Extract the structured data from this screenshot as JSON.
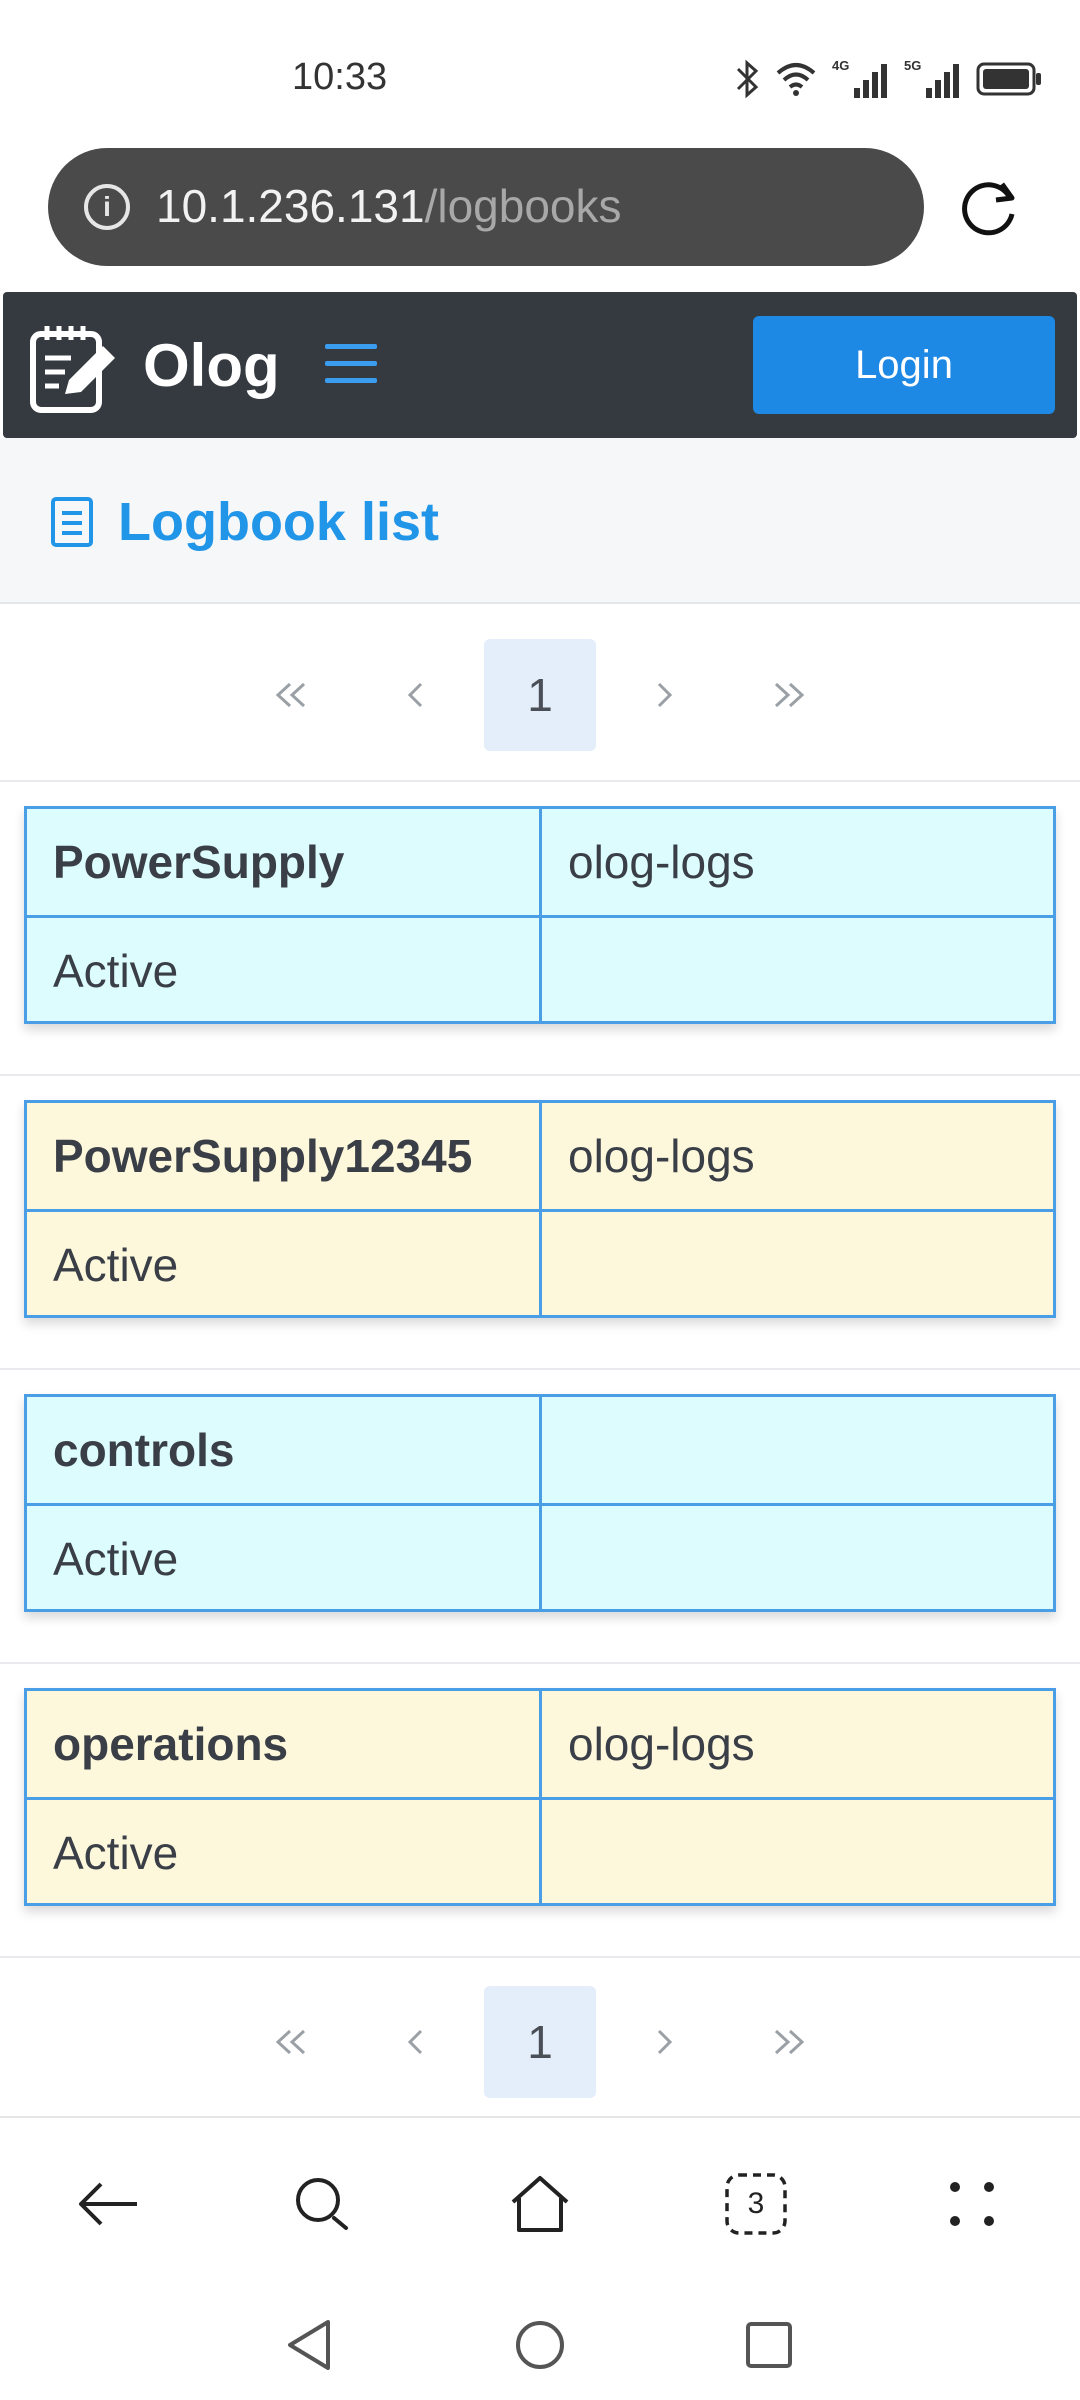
{
  "status_bar": {
    "time": "10:33",
    "icons": [
      "bluetooth-icon",
      "wifi-icon",
      "signal-4g-icon",
      "signal-5g-icon",
      "battery-icon"
    ],
    "network_4g": "4G",
    "network_5g": "5G"
  },
  "browser": {
    "url_host": "10.1.236.131",
    "url_path": "/logbooks",
    "info_glyph": "i",
    "tabs_count": "3"
  },
  "navbar": {
    "brand": "Olog",
    "login_label": "Login",
    "brand_color": "#343a40",
    "accent": "#1e88e5"
  },
  "header": {
    "title": "Logbook list",
    "title_color": "#2196e8"
  },
  "pagination": {
    "current_page": "1"
  },
  "logbooks": [
    {
      "name": "PowerSupply",
      "owner": "olog-logs",
      "state": "Active",
      "row_color": "#dcfcfd"
    },
    {
      "name": "PowerSupply12345",
      "owner": "olog-logs",
      "state": "Active",
      "row_color": "#fdf8dc"
    },
    {
      "name": "controls",
      "owner": "",
      "state": "Active",
      "row_color": "#dcfcfd"
    },
    {
      "name": "operations",
      "owner": "olog-logs",
      "state": "Active",
      "row_color": "#fdf8dc"
    }
  ]
}
